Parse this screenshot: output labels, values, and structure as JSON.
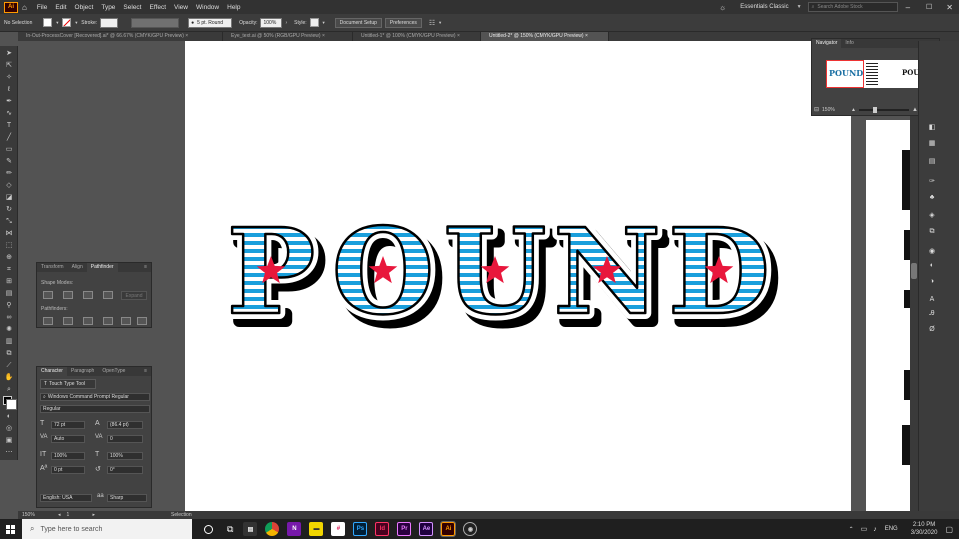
{
  "app": {
    "logo": "Ai",
    "workspace": "Essentials Classic",
    "search_placeholder": "Search Adobe Stock"
  },
  "menu": [
    "File",
    "Edit",
    "Object",
    "Type",
    "Select",
    "Effect",
    "View",
    "Window",
    "Help"
  ],
  "control": {
    "selection_label": "No Selection",
    "stroke_label": "Stroke:",
    "brush_value": "5 pt. Round",
    "opacity_label": "Opacity:",
    "opacity_value": "100%",
    "style_label": "Style:",
    "document_setup": "Document Setup",
    "preferences": "Preferences"
  },
  "tabs": [
    {
      "label": "In-Out-ProcessCover [Recovered].ai* @ 66.67% (CMYK/GPU Preview)",
      "close": "×"
    },
    {
      "label": "Eye_text.ai @ 50% (RGB/GPU Preview)",
      "close": "×"
    },
    {
      "label": "Untitled-1* @ 100% (CMYK/GPU Preview)",
      "close": "×"
    },
    {
      "label": "Untitled-2* @ 150% (CMYK/GPU Preview)",
      "close": "×"
    }
  ],
  "artwork": {
    "text": "POUND",
    "stripe_color": "#1a9fdc",
    "star_color": "#e8173c"
  },
  "navigator": {
    "tabs": [
      "Navigator",
      "Info"
    ],
    "zoom": "150%",
    "thumb_word": "POUND"
  },
  "pathfinder": {
    "tabs": [
      "Transform",
      "Align",
      "Pathfinder"
    ],
    "shape_modes_label": "Shape Modes:",
    "pathfinders_label": "Pathfinders:",
    "expand_label": "Expand"
  },
  "character": {
    "tabs": [
      "Character",
      "Paragraph",
      "OpenType"
    ],
    "touch_type": "Touch Type Tool",
    "font_family": "Windows Command Prompt Regular",
    "font_style": "Regular",
    "font_size": "72 pt",
    "leading": "(86.4 pt)",
    "kerning": "Auto",
    "tracking": "0",
    "vscale": "100%",
    "hscale": "100%",
    "baseline": "0 pt",
    "rotation": "0°",
    "language": "English: USA",
    "aa": "Sharp"
  },
  "status": {
    "zoom": "150%",
    "page": "1",
    "mode": "Selection"
  },
  "taskbar": {
    "search": "Type here to search",
    "apps": [
      {
        "label": "Ps",
        "bg": "#001e36",
        "fg": "#31a8ff"
      },
      {
        "label": "Id",
        "bg": "#49021f",
        "fg": "#ff3366"
      },
      {
        "label": "Pr",
        "bg": "#2a003f",
        "fg": "#ea77ff"
      },
      {
        "label": "Ae",
        "bg": "#1f003f",
        "fg": "#d291ff"
      },
      {
        "label": "Ai",
        "bg": "#330000",
        "fg": "#ff9a00"
      }
    ],
    "lang": "ENG",
    "time": "2:10 PM",
    "date": "3/30/2020"
  }
}
